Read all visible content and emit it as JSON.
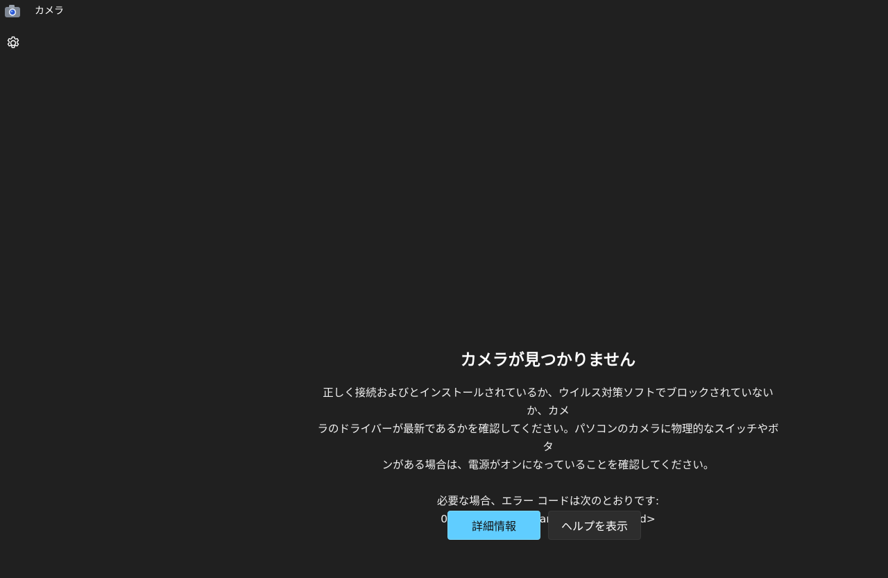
{
  "window": {
    "title": "カメラ"
  },
  "icons": {
    "app": "camera-icon",
    "settings": "gear-icon"
  },
  "colors": {
    "background": "#202020",
    "primary_button": "#60cdff",
    "secondary_button": "#2d2d2d",
    "text": "#ffffff"
  },
  "message": {
    "title": "カメラが見つかりません",
    "body_lines": [
      "正しく接続およびとインストールされているか、ウイルス対策ソフトでブロックされていないか、カメ",
      "ラのドライバーが最新であるかを確認してください。パソコンのカメラに物理的なスイッチやボタ",
      "ンがある場合は、電源がオンになっていることを確認してください。"
    ],
    "error_intro": "必要な場合、エラー コードは次のとおりです:",
    "error_code": "0xA00F4244<NoCamerasAreAttached>"
  },
  "buttons": {
    "details": "詳細情報",
    "help": "ヘルプを表示"
  }
}
